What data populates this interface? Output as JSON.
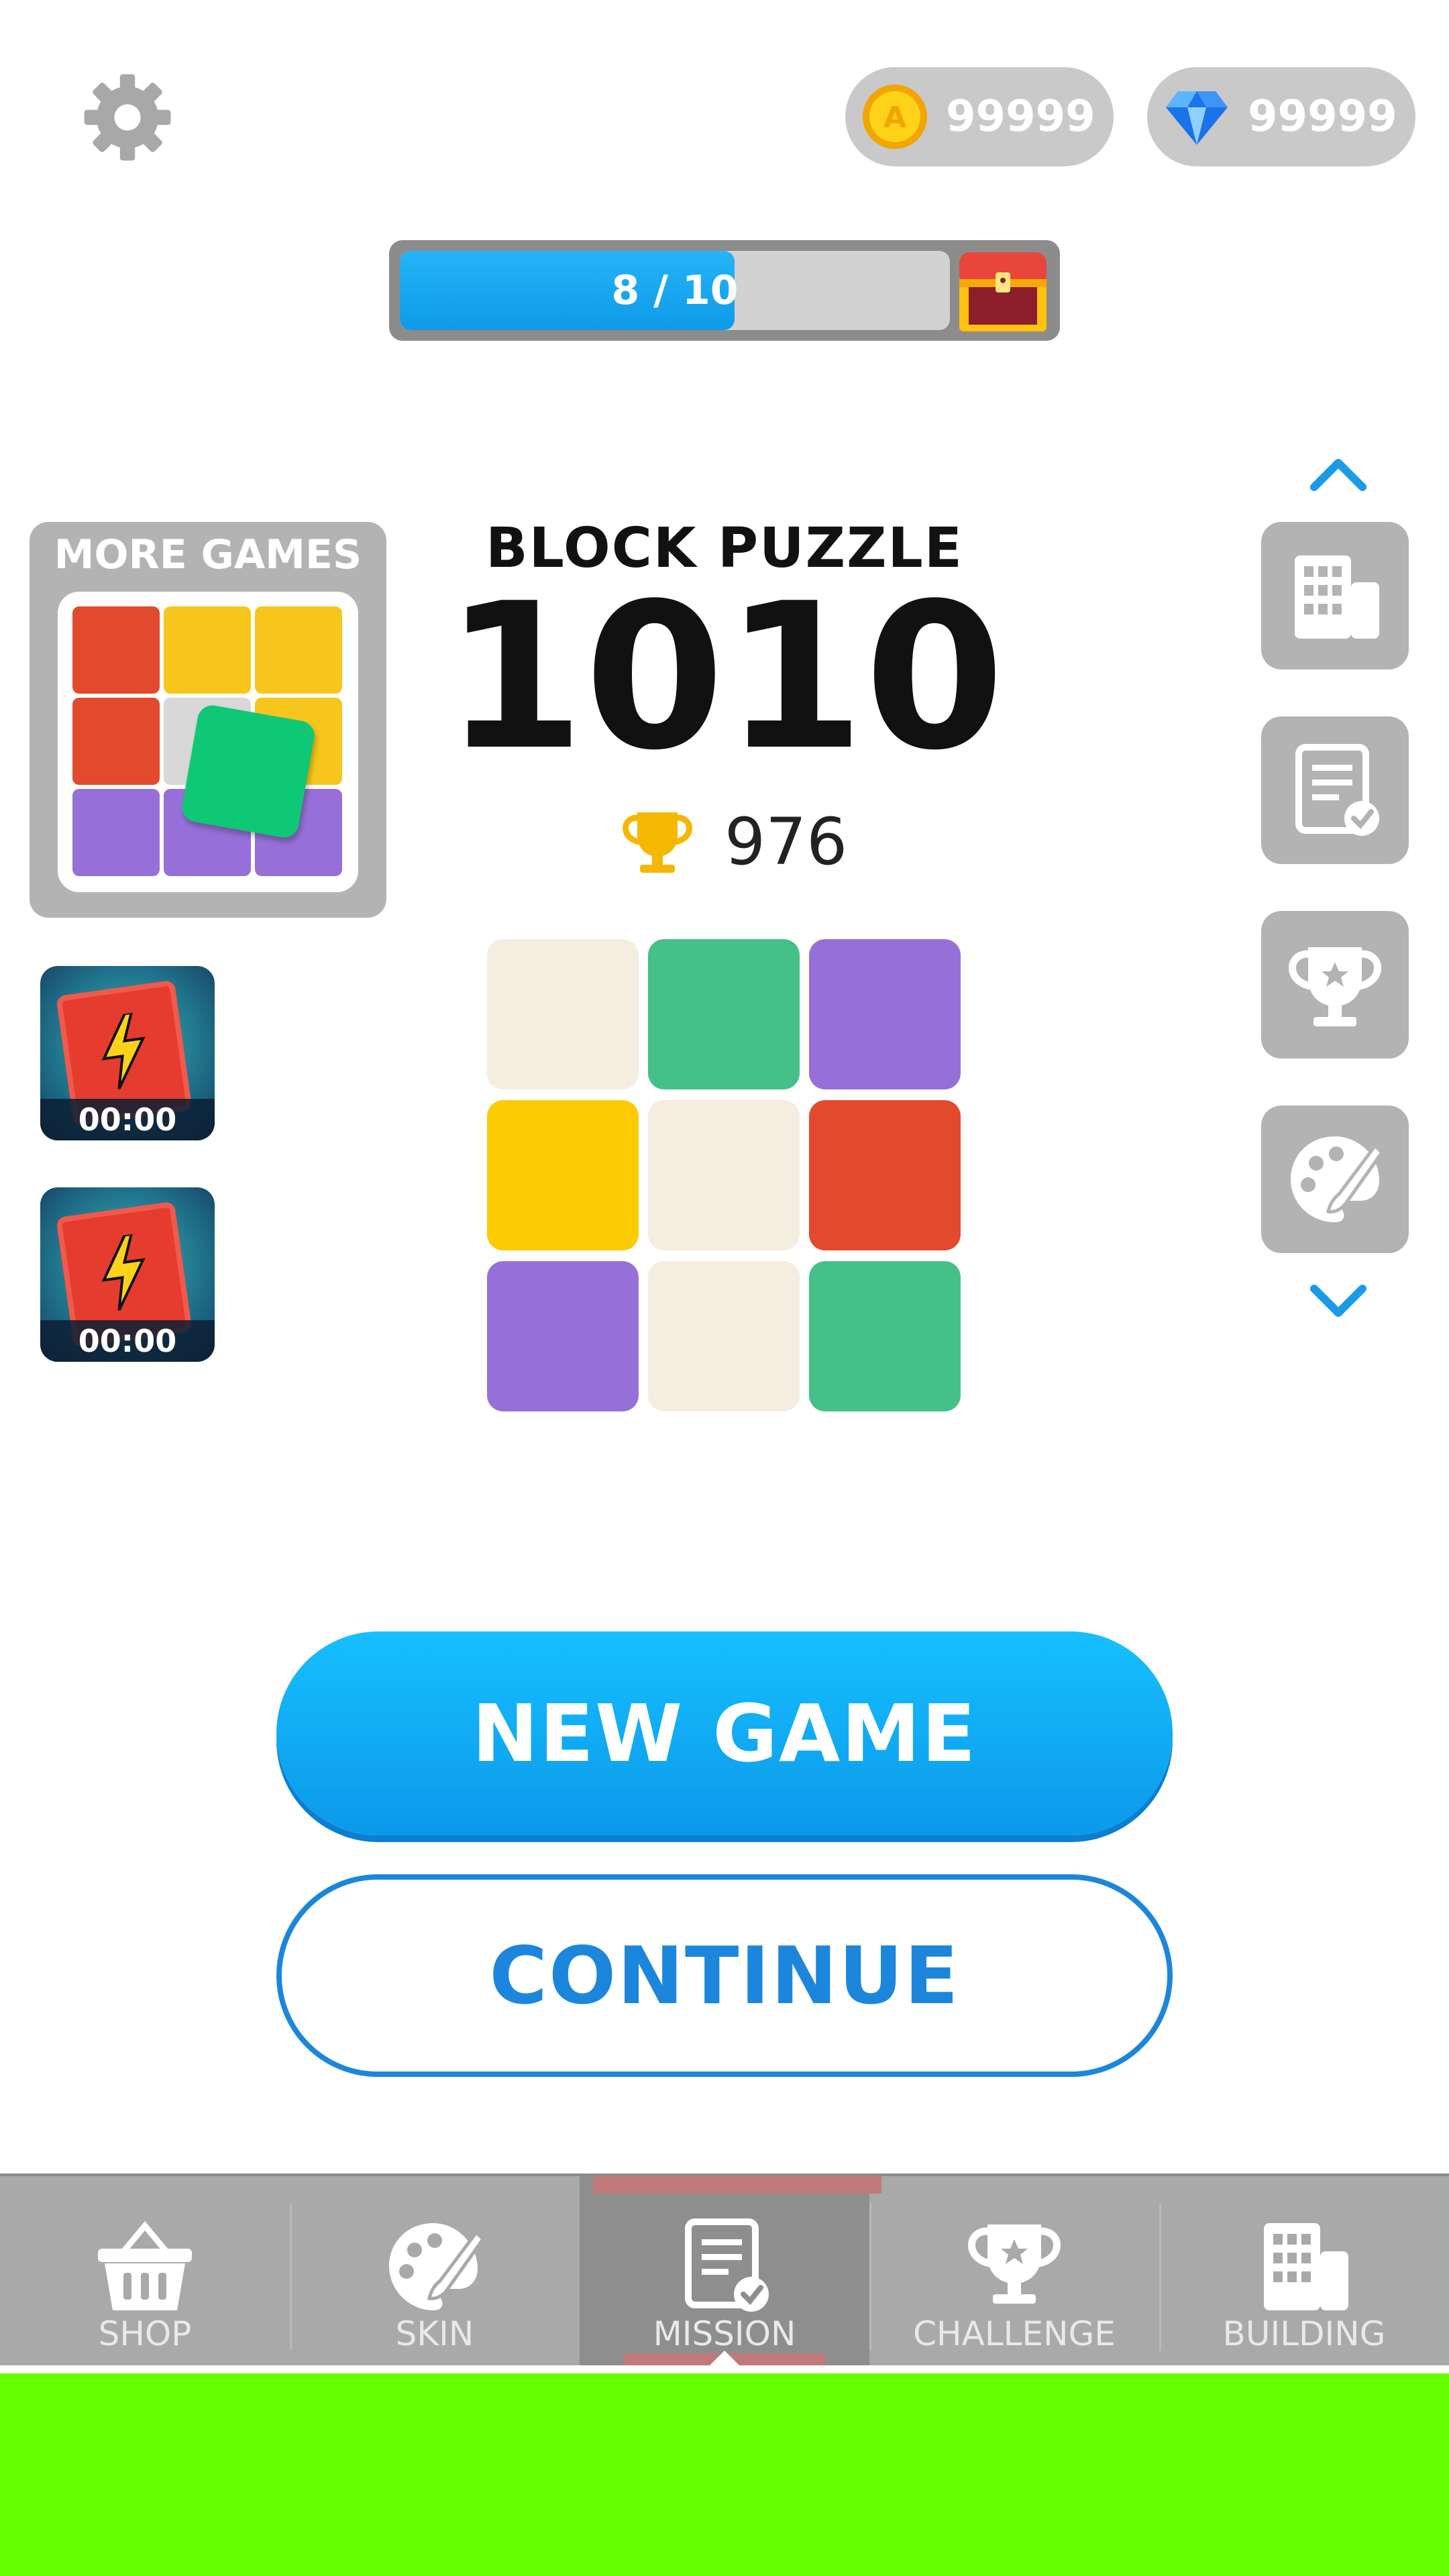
{
  "currency": {
    "coins": "99999",
    "gems": "99999"
  },
  "progress": {
    "text": "8 / 10",
    "current": 8,
    "total": 10
  },
  "more_games": {
    "label": "MORE GAMES"
  },
  "promos": [
    {
      "timer": "00:00"
    },
    {
      "timer": "00:00"
    }
  ],
  "game": {
    "subtitle": "BLOCK PUZZLE",
    "title": "1010",
    "best_score": "976"
  },
  "board_colors": [
    [
      "cream",
      "green",
      "purple"
    ],
    [
      "yellow",
      "cream",
      "red"
    ],
    [
      "purple",
      "cream",
      "green"
    ]
  ],
  "palette": {
    "cream": "#f5ede0",
    "green": "#44c088",
    "purple": "#9670d8",
    "yellow": "#fdcb02",
    "red": "#e14a2c",
    "blue_accent": "#1c86dc",
    "gray_panel": "#b3b3b3"
  },
  "buttons": {
    "new_game": "NEW GAME",
    "continue": "CONTINUE"
  },
  "sidebar": [
    {
      "icon": "building-icon"
    },
    {
      "icon": "mission-icon"
    },
    {
      "icon": "trophy-icon"
    },
    {
      "icon": "palette-icon"
    }
  ],
  "nav": [
    {
      "label": "SHOP",
      "icon": "basket-icon",
      "active": false
    },
    {
      "label": "SKIN",
      "icon": "palette-icon",
      "active": false
    },
    {
      "label": "MISSION",
      "icon": "mission-icon",
      "active": true
    },
    {
      "label": "CHALLENGE",
      "icon": "trophy-icon",
      "active": false
    },
    {
      "label": "BUILDING",
      "icon": "building-icon",
      "active": false
    }
  ]
}
